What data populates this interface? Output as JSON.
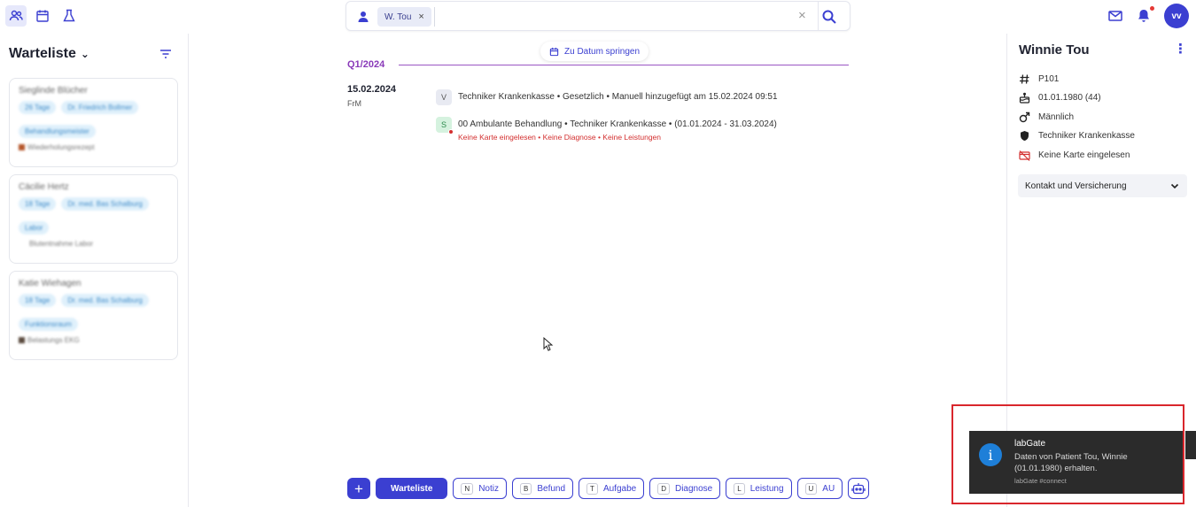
{
  "nav": {
    "icons": [
      "patients-icon",
      "calendar-icon",
      "lab-flask-icon"
    ]
  },
  "search": {
    "chip_label": "W. Tou",
    "chip_close": "×",
    "clear": "×"
  },
  "header": {
    "avatar_initials": "vv"
  },
  "sidebar": {
    "title": "Warteliste",
    "cards": [
      {
        "name": "Sieglinde Blücher",
        "chips": [
          "26 Tage",
          "Dr. Friedrich Bollmer",
          "Behandlungsmeister"
        ],
        "footer": "Wiederholungsrezept"
      },
      {
        "name": "Cäcilie Hertz",
        "chips": [
          "18 Tage",
          "Dr. med. Bas Schalburg",
          "Labor"
        ],
        "footer": "Blutentnahme Labor"
      },
      {
        "name": "Katie Wiehagen",
        "chips": [
          "18 Tage",
          "Dr. med. Bas Schalburg",
          "Funktionsraum"
        ],
        "footer": "Belastungs EKG"
      }
    ]
  },
  "timeline": {
    "jump_label": "Zu Datum springen",
    "quarter": "Q1/2024",
    "date": "15.02.2024",
    "date_sub": "FrM",
    "entries": [
      {
        "badge": "V",
        "text": "Techniker Krankenkasse • Gesetzlich • Manuell hinzugefügt am 15.02.2024 09:51",
        "warning": ""
      },
      {
        "badge": "S",
        "text": "00 Ambulante Behandlung • Techniker Krankenkasse • (01.01.2024 - 31.03.2024)",
        "warning": "Keine Karte eingelesen • Keine Diagnose • Keine Leistungen"
      }
    ]
  },
  "actionbar": {
    "plus": "+",
    "primary": "Warteliste",
    "buttons": [
      {
        "key": "N",
        "label": "Notiz"
      },
      {
        "key": "B",
        "label": "Befund"
      },
      {
        "key": "T",
        "label": "Aufgabe"
      },
      {
        "key": "D",
        "label": "Diagnose"
      },
      {
        "key": "L",
        "label": "Leistung"
      },
      {
        "key": "U",
        "label": "AU"
      }
    ]
  },
  "patient": {
    "name": "Winnie Tou",
    "more": "⋮",
    "id": "P101",
    "birthdate": "01.01.1980 (44)",
    "gender": "Männlich",
    "insurance": "Techniker Krankenkasse",
    "card_status": "Keine Karte eingelesen",
    "accordion": "Kontakt und Versicherung"
  },
  "toast": {
    "icon": "i",
    "title": "labGate",
    "body": "Daten von Patient Tou, Winnie (01.01.1980) erhalten.",
    "footer": "labGate #connect"
  },
  "colors": {
    "accent": "#3b3fd1",
    "quarter": "#8a3ab9",
    "warning": "#d32f2f",
    "toast_bg": "#2b2b2b",
    "highlight_frame": "#d9262c"
  }
}
